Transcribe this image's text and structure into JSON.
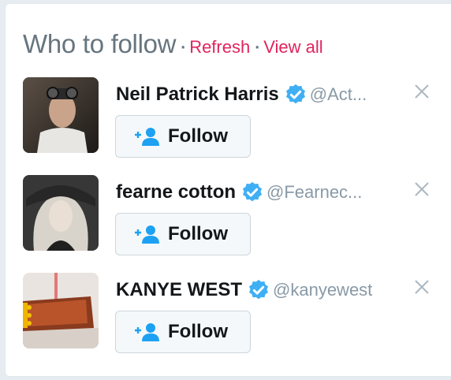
{
  "widget": {
    "title": "Who to follow",
    "separator": "·",
    "refresh_label": "Refresh",
    "view_all_label": "View all"
  },
  "colors": {
    "link": "#e0245e",
    "verified": "#1da1f2",
    "follow_icon": "#1da1f2",
    "muted": "#8899a6"
  },
  "users": [
    {
      "name": "Neil Patrick Harris",
      "handle": "@Act...",
      "verified": true,
      "follow_label": "Follow",
      "avatar_icon": "photo-avatar"
    },
    {
      "name": "fearne cotton",
      "handle": "@Fearnec...",
      "verified": true,
      "follow_label": "Follow",
      "avatar_icon": "photo-avatar"
    },
    {
      "name": "KANYE WEST",
      "handle": "@kanyewest",
      "verified": true,
      "follow_label": "Follow",
      "avatar_icon": "photo-avatar"
    }
  ],
  "icons": {
    "verified": "verified-badge-icon",
    "dismiss": "close-icon",
    "follow": "add-user-icon"
  }
}
